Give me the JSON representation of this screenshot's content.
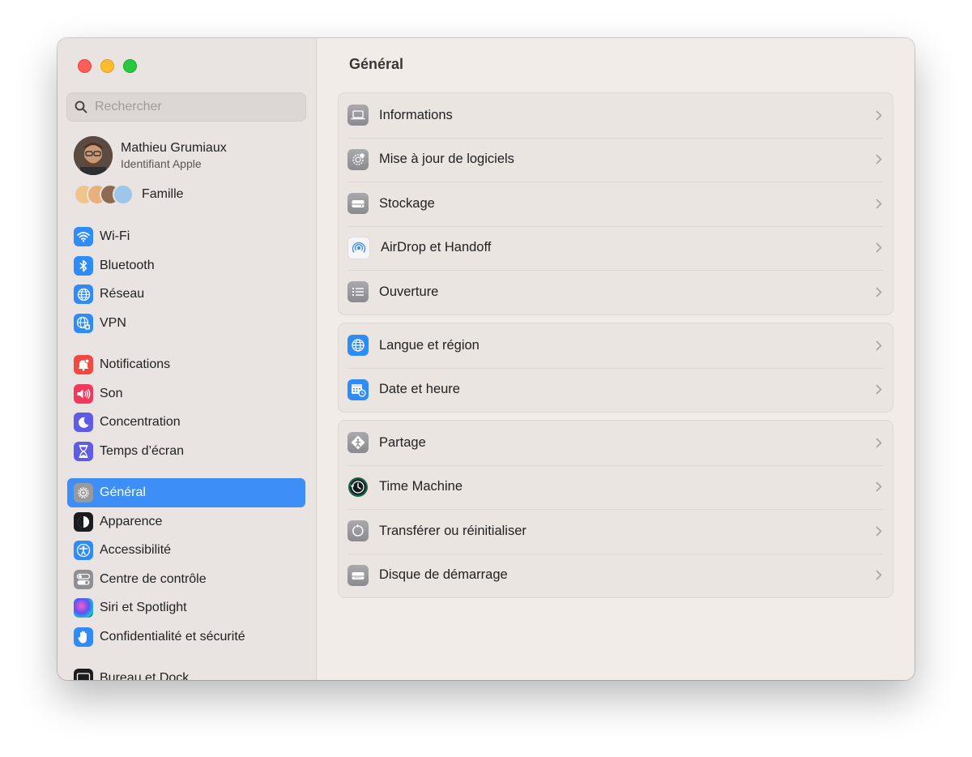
{
  "search": {
    "placeholder": "Rechercher"
  },
  "user": {
    "name": "Mathieu Grumiaux",
    "subtitle": "Identifiant Apple"
  },
  "family": {
    "label": "Famille"
  },
  "sidebar": {
    "items": [
      {
        "label": "Wi-Fi",
        "icon": "wifi-icon",
        "color": "#2f8cf6"
      },
      {
        "label": "Bluetooth",
        "icon": "bluetooth-icon",
        "color": "#2f8cf6"
      },
      {
        "label": "Réseau",
        "icon": "globe-icon",
        "color": "#2f8cf6"
      },
      {
        "label": "VPN",
        "icon": "vpn-globe-icon",
        "color": "#2f8cf6"
      },
      {
        "label": "Notifications",
        "icon": "bell-icon",
        "color": "#f24a41"
      },
      {
        "label": "Son",
        "icon": "speaker-icon",
        "color": "#f0395c"
      },
      {
        "label": "Concentration",
        "icon": "moon-icon",
        "color": "#5e5ce6"
      },
      {
        "label": "Temps d’écran",
        "icon": "hourglass-icon",
        "color": "#5e5ce6"
      },
      {
        "label": "Général",
        "icon": "gear-icon",
        "color": "#8e8e93"
      },
      {
        "label": "Apparence",
        "icon": "appearance-icon",
        "color": "#1c1c1e"
      },
      {
        "label": "Accessibilité",
        "icon": "accessibility-icon",
        "color": "#2f8cf6"
      },
      {
        "label": "Centre de contrôle",
        "icon": "toggles-icon",
        "color": "#8e8e93"
      },
      {
        "label": "Siri et Spotlight",
        "icon": "siri-icon",
        "color": "#2b2b5c"
      },
      {
        "label": "Confidentialité et sécurité",
        "icon": "hand-icon",
        "color": "#2f8cf6"
      },
      {
        "label": "Bureau et Dock",
        "icon": "dock-icon",
        "color": "#1c1c1e"
      }
    ],
    "selected": "Général"
  },
  "main": {
    "title": "Général",
    "groups": [
      [
        {
          "label": "Informations",
          "icon": "laptop-icon"
        },
        {
          "label": "Mise à jour de logiciels",
          "icon": "software-update-gear-icon"
        },
        {
          "label": "Stockage",
          "icon": "drive-icon"
        },
        {
          "label": "AirDrop et Handoff",
          "icon": "airdrop-icon"
        },
        {
          "label": "Ouverture",
          "icon": "list-icon"
        }
      ],
      [
        {
          "label": "Langue et région",
          "icon": "globe-icon"
        },
        {
          "label": "Date et heure",
          "icon": "calendar-clock-icon"
        }
      ],
      [
        {
          "label": "Partage",
          "icon": "sharing-icon"
        },
        {
          "label": "Time Machine",
          "icon": "time-machine-icon"
        },
        {
          "label": "Transférer ou réinitialiser",
          "icon": "reset-icon"
        },
        {
          "label": "Disque de démarrage",
          "icon": "startup-disk-icon"
        }
      ]
    ]
  }
}
